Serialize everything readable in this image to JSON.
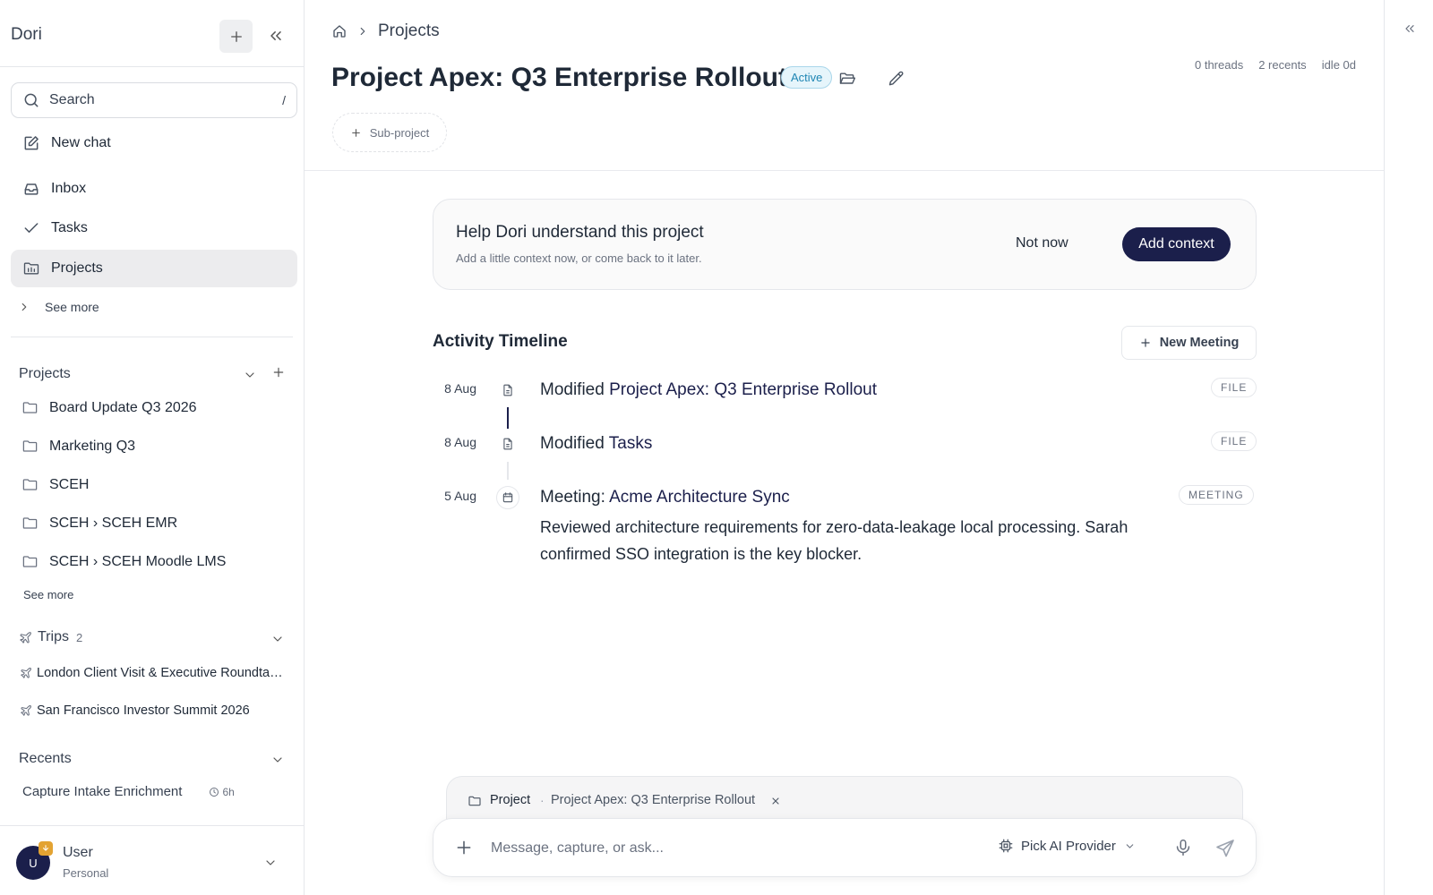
{
  "sidebar": {
    "app_name": "Dori",
    "search": {
      "label": "Search",
      "shortcut": "/"
    },
    "nav": [
      {
        "label": "New chat",
        "icon": "edit-icon"
      },
      {
        "label": "Inbox",
        "icon": "inbox-icon"
      },
      {
        "label": "Tasks",
        "icon": "check-icon"
      },
      {
        "label": "Projects",
        "icon": "projects-icon",
        "active": true
      }
    ],
    "see_more_label": "See more",
    "projects_section": {
      "title": "Projects",
      "items": [
        "Board Update Q3 2026",
        "Marketing Q3",
        "SCEH",
        "SCEH › SCEH EMR",
        "SCEH › SCEH Moodle LMS"
      ],
      "see_more_label": "See more"
    },
    "trips_section": {
      "title": "Trips",
      "count": "2",
      "items": [
        "London Client Visit & Executive Roundtable",
        "San Francisco Investor Summit 2026"
      ]
    },
    "recents_section": {
      "title": "Recents",
      "items": [
        {
          "label": "Capture Intake Enrichment",
          "time": "6h"
        }
      ]
    },
    "user": {
      "initial": "U",
      "name": "User",
      "workspace": "Personal",
      "badge_color": "#e3a332"
    }
  },
  "main": {
    "breadcrumb": {
      "current": "Projects"
    },
    "title": "Project Apex: Q3 Enterprise Rollout",
    "status": "Active",
    "stats": {
      "threads": "0 threads",
      "recents": "2 recents",
      "idle": "idle 0d"
    },
    "subproject_label": "Sub-project",
    "help_card": {
      "title": "Help Dori understand this project",
      "subtitle": "Add a little context now, or come back to it later.",
      "dismiss_label": "Not now",
      "action_label": "Add context"
    },
    "timeline": {
      "title": "Activity Timeline",
      "new_meeting_label": "New Meeting",
      "items": [
        {
          "date": "8 Aug",
          "prefix": "Modified",
          "link": "Project Apex: Q3 Enterprise Rollout",
          "tag": "FILE",
          "icon": "file-icon"
        },
        {
          "date": "8 Aug",
          "prefix": "Modified",
          "link": "Tasks",
          "tag": "FILE",
          "icon": "file-icon"
        },
        {
          "date": "5 Aug",
          "prefix": "Meeting:",
          "link": "Acme Architecture Sync",
          "tag": "MEETING",
          "icon": "calendar-icon",
          "description": "Reviewed architecture requirements for zero-data-leakage local processing. Sarah confirmed SSO integration is the key blocker."
        }
      ]
    },
    "context_chip": {
      "label": "Project",
      "separator": "·",
      "value": "Project Apex: Q3 Enterprise Rollout"
    },
    "composer": {
      "placeholder": "Message, capture, or ask...",
      "provider_label": "Pick AI Provider"
    }
  },
  "colors": {
    "accent": "#1b1f4b",
    "active_badge_text": "#1f86b4",
    "active_badge_bg": "#e6f5fb"
  }
}
